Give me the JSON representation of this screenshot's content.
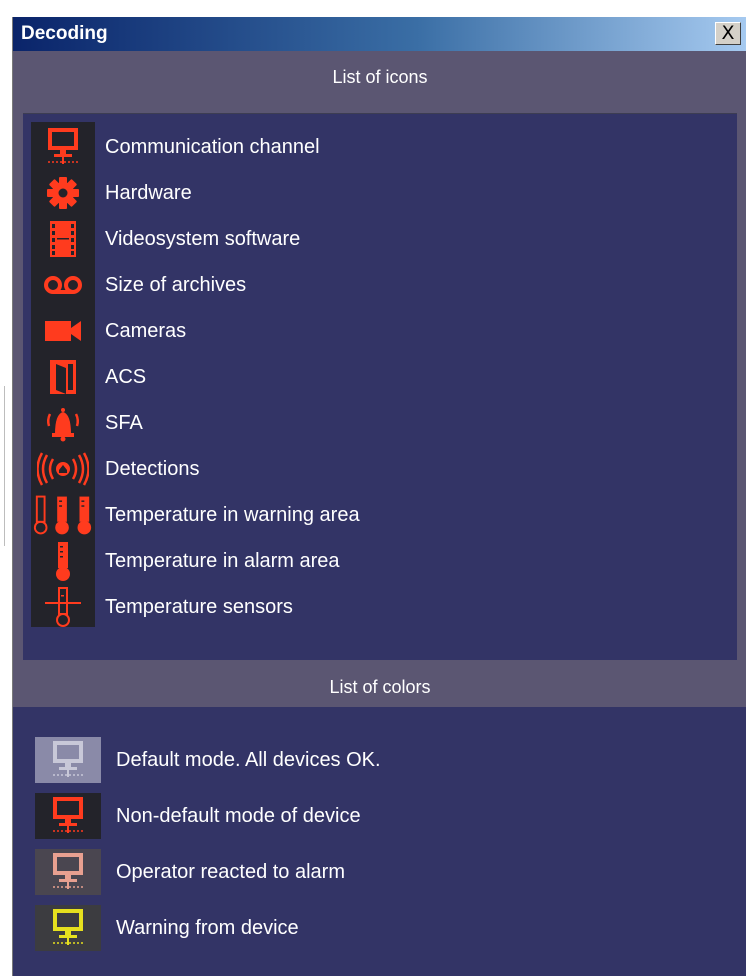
{
  "window": {
    "title": "Decoding",
    "close_label": "X"
  },
  "icons_section": {
    "header": "List of icons",
    "items": [
      {
        "icon": "network-monitor-icon",
        "label": "Communication channel"
      },
      {
        "icon": "gear-icon",
        "label": "Hardware"
      },
      {
        "icon": "film-strip-icon",
        "label": "Videosystem software"
      },
      {
        "icon": "tape-reel-icon",
        "label": "Size of archives"
      },
      {
        "icon": "video-camera-icon",
        "label": "Cameras"
      },
      {
        "icon": "door-icon",
        "label": "ACS"
      },
      {
        "icon": "alarm-bell-icon",
        "label": "SFA"
      },
      {
        "icon": "signal-waves-icon",
        "label": "Detections"
      },
      {
        "icon": "three-thermometers-icon",
        "label": "Temperature in warning area"
      },
      {
        "icon": "filled-thermometer-icon",
        "label": "Temperature in alarm area"
      },
      {
        "icon": "thermometer-sensor-icon",
        "label": "Temperature sensors"
      }
    ]
  },
  "colors_section": {
    "header": "List of colors",
    "items": [
      {
        "icon": "network-monitor-icon",
        "label": "Default mode. All devices OK.",
        "icon_color": "#c8c8d8",
        "bg_color": "#8a8aa8"
      },
      {
        "icon": "network-monitor-icon",
        "label": "Non-default mode of device",
        "icon_color": "#ff3b1e",
        "bg_color": "#23232a"
      },
      {
        "icon": "network-monitor-icon",
        "label": "Operator reacted to alarm",
        "icon_color": "#e8a090",
        "bg_color": "#4a4650"
      },
      {
        "icon": "network-monitor-icon",
        "label": "Warning from device",
        "icon_color": "#e6e01e",
        "bg_color": "#3c3c40"
      }
    ]
  },
  "colors": {
    "accent_icon": "#ff3b1e",
    "panel_bg": "#333466",
    "header_bg": "#5b5672"
  }
}
